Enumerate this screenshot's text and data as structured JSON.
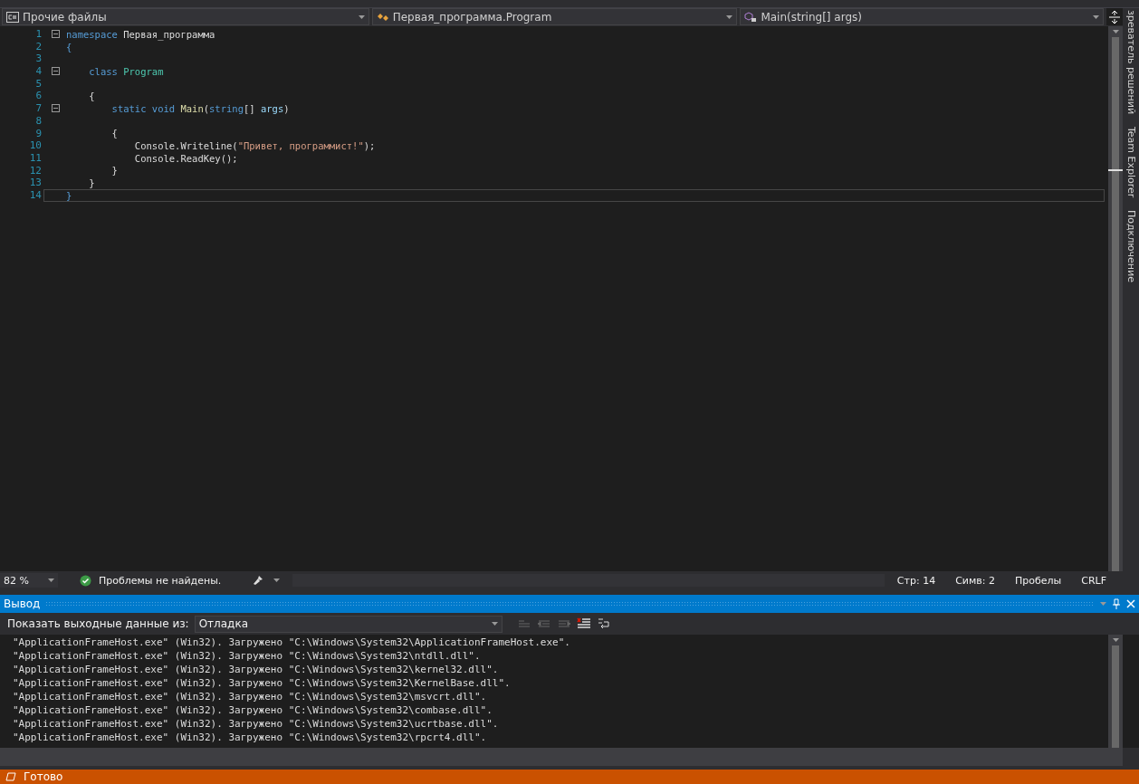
{
  "navigation_bar": {
    "project": "Прочие файлы",
    "type": "Первая_программа.Program",
    "member": "Main(string[] args)"
  },
  "editor": {
    "lines": [
      {
        "number": "1",
        "fold": true,
        "current": false,
        "tokens": [
          {
            "kind": "keyword",
            "text": "namespace"
          },
          {
            "kind": "plain",
            "text": " Первая_программа"
          }
        ]
      },
      {
        "number": "2",
        "fold": false,
        "current": false,
        "tokens": [
          {
            "kind": "brace",
            "text": "{"
          }
        ]
      },
      {
        "number": "3",
        "fold": false,
        "current": false
      },
      {
        "number": "4",
        "fold": true,
        "current": false,
        "tokens": [
          {
            "kind": "keyword",
            "text": "    class"
          },
          {
            "kind": "type",
            "text": " Program"
          }
        ]
      },
      {
        "number": "5",
        "fold": false,
        "current": false
      },
      {
        "number": "6",
        "fold": false,
        "current": false,
        "tokens": [
          {
            "kind": "plain",
            "text": "    {"
          }
        ]
      },
      {
        "number": "7",
        "fold": true,
        "current": false,
        "tokens": [
          {
            "kind": "keyword",
            "text": "        static void"
          },
          {
            "kind": "method",
            "text": " Main"
          },
          {
            "kind": "plain",
            "text": "("
          },
          {
            "kind": "keyword",
            "text": "string"
          },
          {
            "kind": "plain",
            "text": "[] "
          },
          {
            "kind": "param",
            "text": "args"
          },
          {
            "kind": "plain",
            "text": ")"
          }
        ]
      },
      {
        "number": "8",
        "fold": false,
        "current": false
      },
      {
        "number": "9",
        "fold": false,
        "current": false,
        "tokens": [
          {
            "kind": "plain",
            "text": "        {"
          }
        ]
      },
      {
        "number": "10",
        "fold": false,
        "current": false,
        "tokens": [
          {
            "kind": "plain",
            "text": "            Console.Writeline("
          },
          {
            "kind": "string",
            "text": "\"Привет, программист!\""
          },
          {
            "kind": "plain",
            "text": ");"
          }
        ]
      },
      {
        "number": "11",
        "fold": false,
        "current": false,
        "tokens": [
          {
            "kind": "plain",
            "text": "            Console.ReadKey();"
          }
        ]
      },
      {
        "number": "12",
        "fold": false,
        "current": false,
        "tokens": [
          {
            "kind": "plain",
            "text": "        }"
          }
        ]
      },
      {
        "number": "13",
        "fold": false,
        "current": false,
        "tokens": [
          {
            "kind": "plain",
            "text": "    }"
          }
        ]
      },
      {
        "number": "14",
        "fold": false,
        "current": true,
        "tokens": [
          {
            "kind": "brace",
            "text": "}"
          }
        ]
      }
    ]
  },
  "side_tabs": [
    "зреватель решений",
    "Team Explorer",
    "Подключение"
  ],
  "editor_status": {
    "zoom": "82 %",
    "issues": "Проблемы не найдены.",
    "line": "Стр: 14",
    "column": "Симв: 2",
    "indent": "Пробелы",
    "line_ending": "CRLF"
  },
  "output": {
    "title": "Вывод",
    "source_label": "Показать выходные данные из:",
    "source": "Отладка",
    "lines": [
      "\"ApplicationFrameHost.exe\" (Win32). Загружено \"C:\\Windows\\System32\\ApplicationFrameHost.exe\".",
      "\"ApplicationFrameHost.exe\" (Win32). Загружено \"C:\\Windows\\System32\\ntdll.dll\".",
      "\"ApplicationFrameHost.exe\" (Win32). Загружено \"C:\\Windows\\System32\\kernel32.dll\".",
      "\"ApplicationFrameHost.exe\" (Win32). Загружено \"C:\\Windows\\System32\\KernelBase.dll\".",
      "\"ApplicationFrameHost.exe\" (Win32). Загружено \"C:\\Windows\\System32\\msvcrt.dll\".",
      "\"ApplicationFrameHost.exe\" (Win32). Загружено \"C:\\Windows\\System32\\combase.dll\".",
      "\"ApplicationFrameHost.exe\" (Win32). Загружено \"C:\\Windows\\System32\\ucrtbase.dll\".",
      "\"ApplicationFrameHost.exe\" (Win32). Загружено \"C:\\Windows\\System32\\rpcrt4.dll\"."
    ]
  },
  "status_bar": {
    "text": "Готово"
  }
}
